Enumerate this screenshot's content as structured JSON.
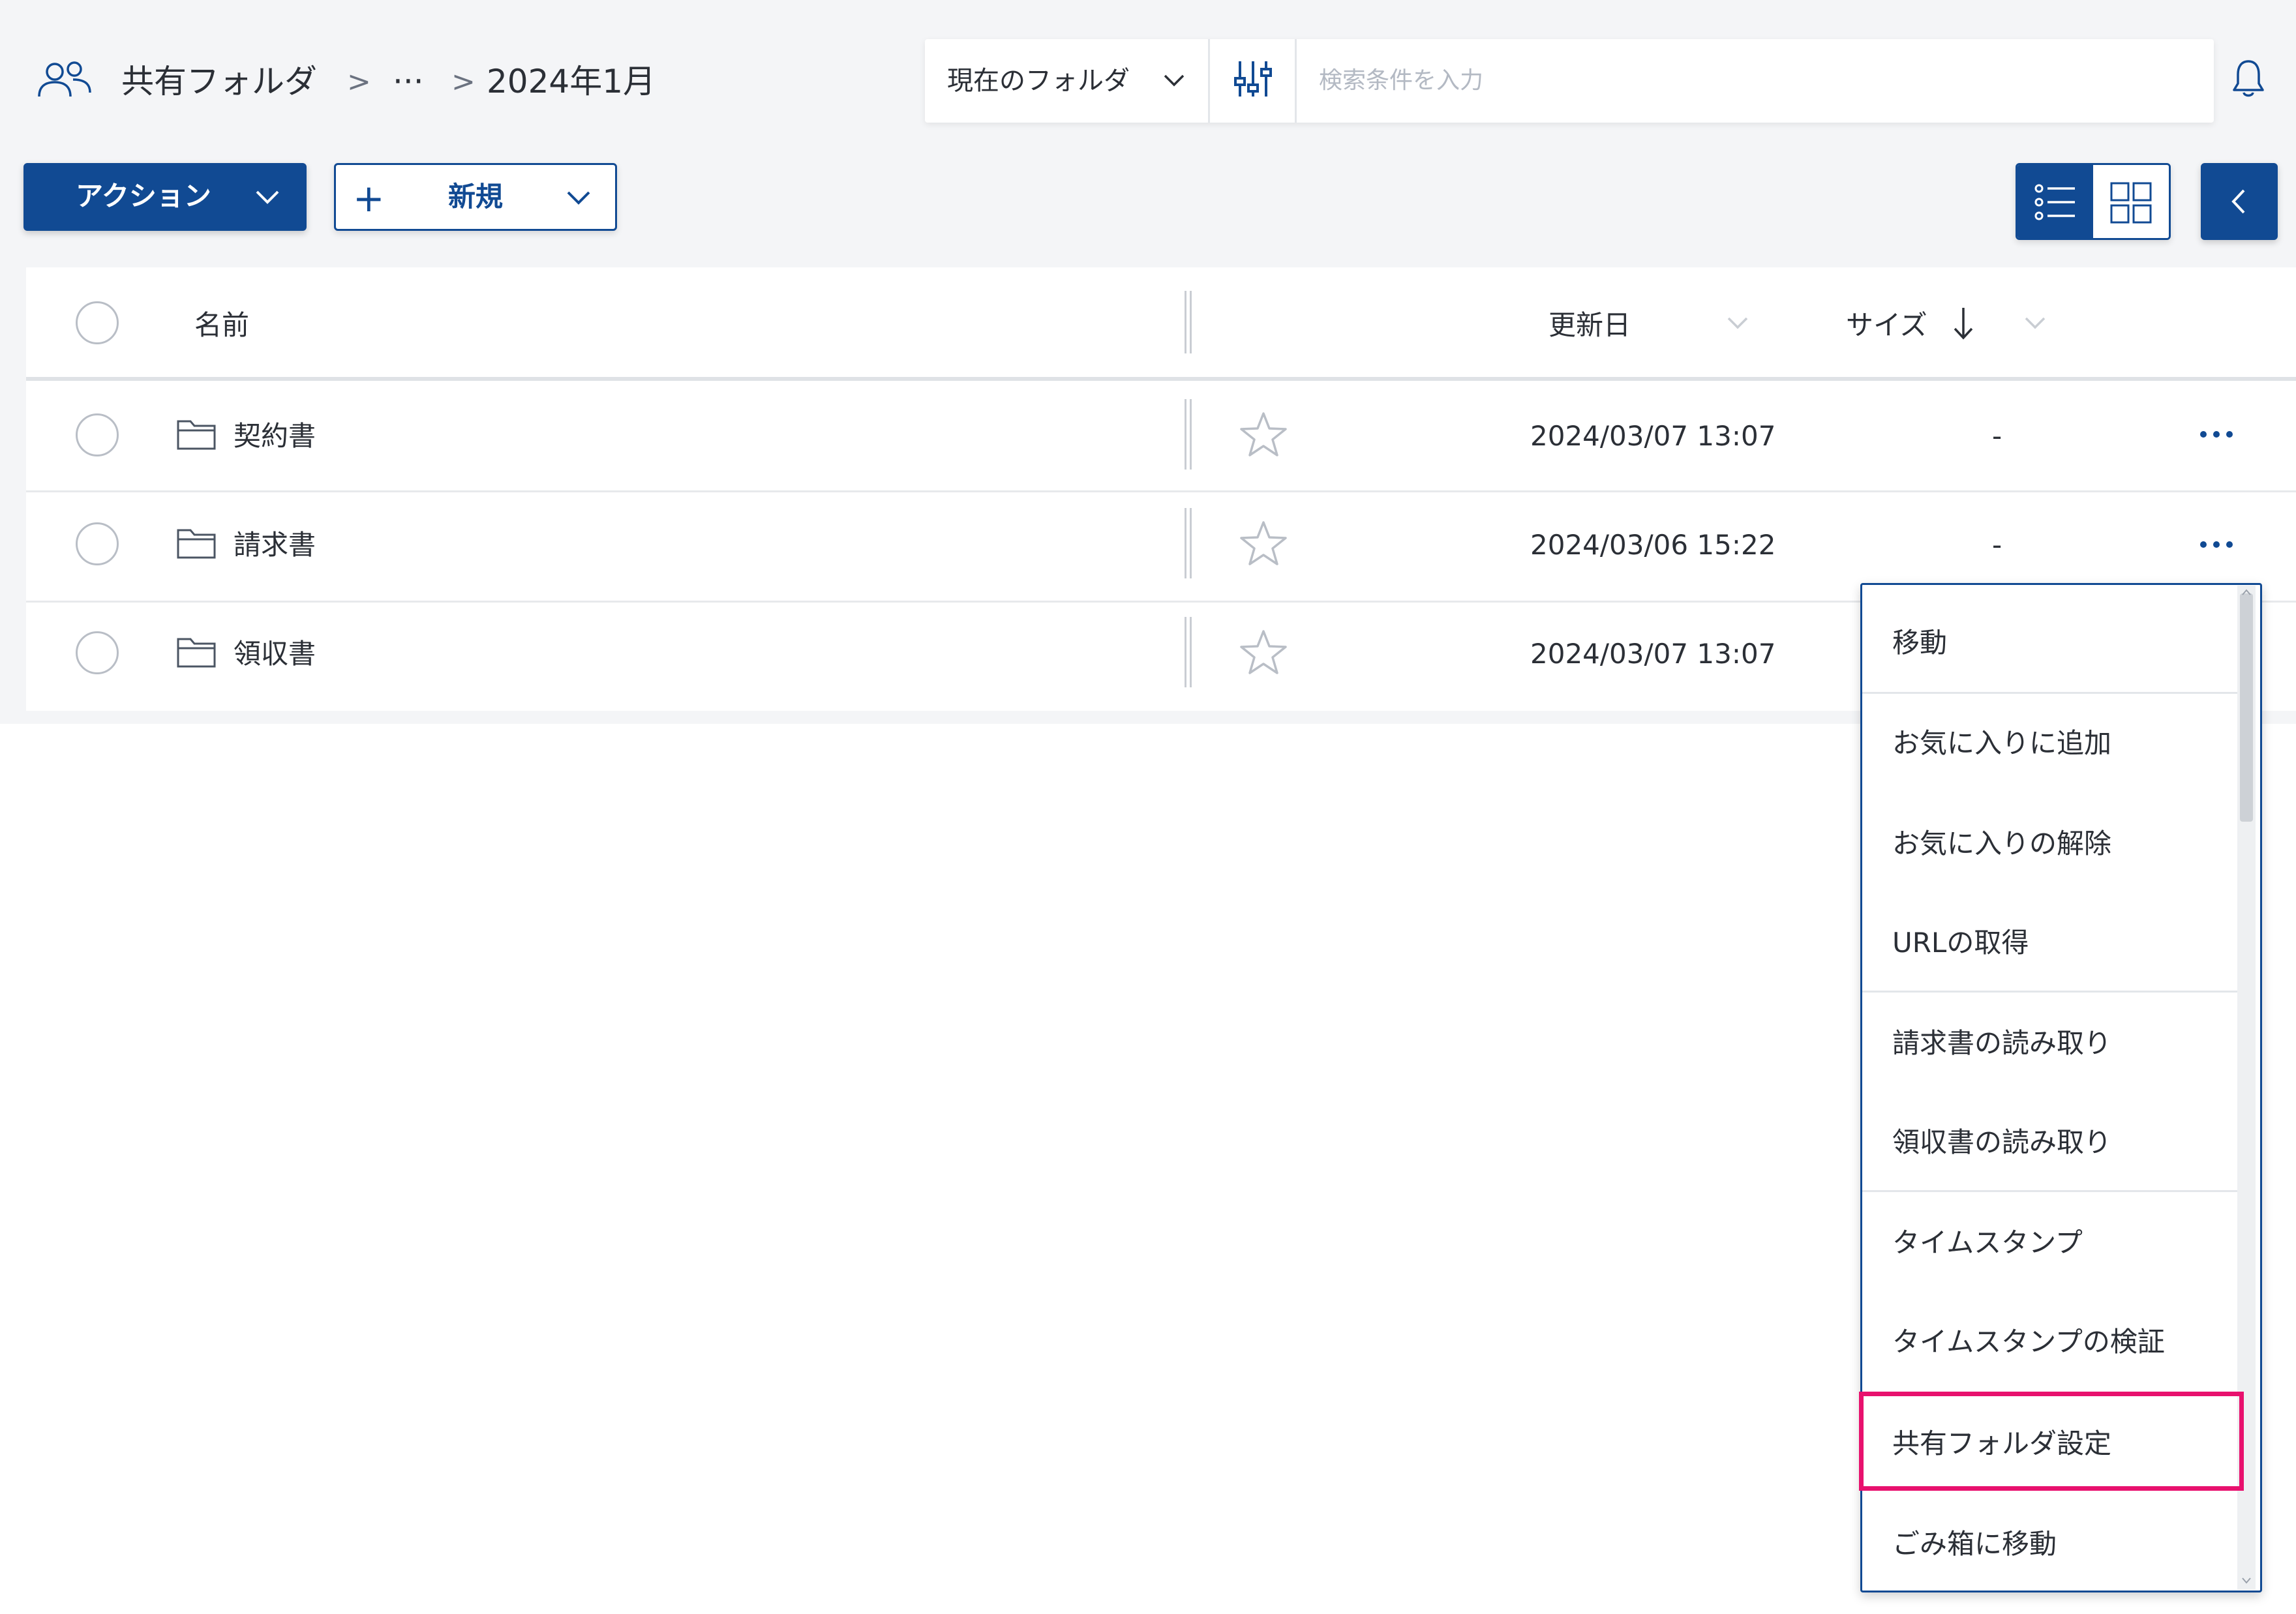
{
  "breadcrumb": {
    "root": "共有フォルダ",
    "sep": ">",
    "ellipsis": "···",
    "current": "2024年1月"
  },
  "search": {
    "scope": "現在のフォルダ",
    "placeholder": "検索条件を入力"
  },
  "toolbar": {
    "action_label": "アクション",
    "new_plus": "+",
    "new_label": "新規"
  },
  "table": {
    "headers": {
      "name": "名前",
      "updated": "更新日",
      "size": "サイズ"
    },
    "rows": [
      {
        "name": "契約書",
        "updated": "2024/03/07 13:07",
        "size": "-"
      },
      {
        "name": "請求書",
        "updated": "2024/03/06 15:22",
        "size": "-"
      },
      {
        "name": "領収書",
        "updated": "2024/03/07 13:07",
        "size": "-"
      }
    ]
  },
  "menu": {
    "items": [
      "移動",
      "お気に入りに追加",
      "お気に入りの解除",
      "URLの取得",
      "請求書の読み取り",
      "領収書の読み取り",
      "タイムスタンプ",
      "タイムスタンプの検証",
      "共有フォルダ設定",
      "ごみ箱に移動"
    ],
    "highlighted": "共有フォルダ設定"
  },
  "colors": {
    "primary": "#114a93",
    "highlight": "#e8116e",
    "background": "#f4f5f7"
  }
}
